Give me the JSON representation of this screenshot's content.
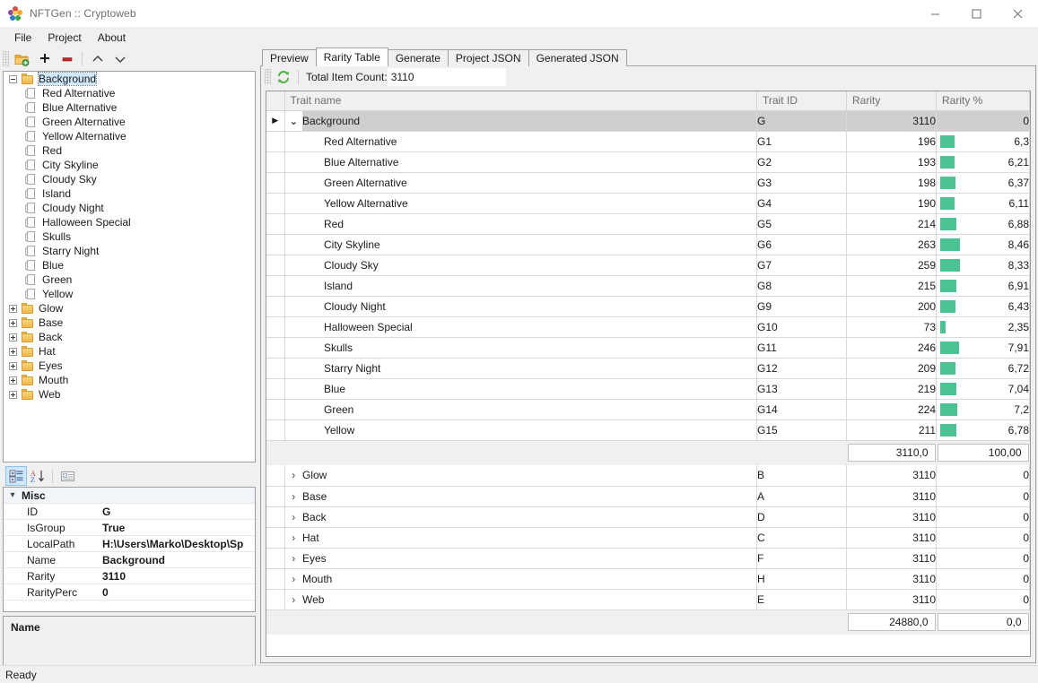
{
  "window": {
    "title": "NFTGen :: Cryptoweb",
    "icon": "app-flower-icon",
    "minimize": "minimize-icon",
    "maximize": "maximize-icon",
    "close": "close-icon"
  },
  "menu": {
    "items": [
      {
        "label": "File"
      },
      {
        "label": "Project"
      },
      {
        "label": "About"
      }
    ]
  },
  "tree_toolbar": {
    "buttons": [
      {
        "name": "add-folder-icon",
        "title": "Add group"
      },
      {
        "name": "plus-icon",
        "title": "Add item"
      },
      {
        "name": "minus-icon",
        "title": "Remove item"
      },
      {
        "name": "move-up-icon",
        "title": "Move up"
      },
      {
        "name": "move-down-icon",
        "title": "Move down"
      }
    ]
  },
  "tree": {
    "nodes": [
      {
        "label": "Background",
        "type": "folder",
        "expanded": true,
        "selected": true
      },
      {
        "label": "Red Alternative",
        "type": "file"
      },
      {
        "label": "Blue Alternative",
        "type": "file"
      },
      {
        "label": "Green Alternative",
        "type": "file"
      },
      {
        "label": "Yellow Alternative",
        "type": "file"
      },
      {
        "label": "Red",
        "type": "file"
      },
      {
        "label": "City Skyline",
        "type": "file"
      },
      {
        "label": "Cloudy Sky",
        "type": "file"
      },
      {
        "label": "Island",
        "type": "file"
      },
      {
        "label": "Cloudy Night",
        "type": "file"
      },
      {
        "label": "Halloween Special",
        "type": "file"
      },
      {
        "label": "Skulls",
        "type": "file"
      },
      {
        "label": "Starry Night",
        "type": "file"
      },
      {
        "label": "Blue",
        "type": "file"
      },
      {
        "label": "Green",
        "type": "file"
      },
      {
        "label": "Yellow",
        "type": "file"
      },
      {
        "label": "Glow",
        "type": "folder",
        "expanded": false
      },
      {
        "label": "Base",
        "type": "folder",
        "expanded": false
      },
      {
        "label": "Back",
        "type": "folder",
        "expanded": false
      },
      {
        "label": "Hat",
        "type": "folder",
        "expanded": false
      },
      {
        "label": "Eyes",
        "type": "folder",
        "expanded": false
      },
      {
        "label": "Mouth",
        "type": "folder",
        "expanded": false
      },
      {
        "label": "Web",
        "type": "folder",
        "expanded": false
      }
    ]
  },
  "propgrid_toolbar": {
    "buttons": [
      {
        "name": "categorized-view-icon",
        "active": true
      },
      {
        "name": "alphabetical-sort-icon",
        "active": false
      },
      {
        "name": "property-pages-icon",
        "active": false
      }
    ]
  },
  "propgrid": {
    "category": "Misc",
    "rows": [
      {
        "name": "ID",
        "value": "G"
      },
      {
        "name": "IsGroup",
        "value": "True"
      },
      {
        "name": "LocalPath",
        "value": "H:\\Users\\Marko\\Desktop\\Sp"
      },
      {
        "name": "Name",
        "value": "Background"
      },
      {
        "name": "Rarity",
        "value": "3110"
      },
      {
        "name": "RarityPerc",
        "value": "0"
      }
    ]
  },
  "description_box": {
    "title": "Name",
    "text": ""
  },
  "tabs": [
    {
      "label": "Preview",
      "active": false
    },
    {
      "label": "Rarity Table",
      "active": true
    },
    {
      "label": "Generate",
      "active": false
    },
    {
      "label": "Project JSON",
      "active": false
    },
    {
      "label": "Generated JSON",
      "active": false
    }
  ],
  "grid_toolbar": {
    "refresh_icon": "refresh-icon",
    "total_label": "Total Item Count:",
    "total_value": "3110"
  },
  "table": {
    "columns": [
      "Trait name",
      "Trait ID",
      "Rarity",
      "Rarity %"
    ],
    "accent_color": "#4bc291",
    "expanded_group": {
      "name": "Background",
      "id": "G",
      "rarity": "3110",
      "pct": "0",
      "children": [
        {
          "name": "Red Alternative",
          "id": "G1",
          "rarity": "196",
          "pct": "6,3",
          "pct_value": 6.3
        },
        {
          "name": "Blue Alternative",
          "id": "G2",
          "rarity": "193",
          "pct": "6,21",
          "pct_value": 6.21
        },
        {
          "name": "Green Alternative",
          "id": "G3",
          "rarity": "198",
          "pct": "6,37",
          "pct_value": 6.37
        },
        {
          "name": "Yellow Alternative",
          "id": "G4",
          "rarity": "190",
          "pct": "6,11",
          "pct_value": 6.11
        },
        {
          "name": "Red",
          "id": "G5",
          "rarity": "214",
          "pct": "6,88",
          "pct_value": 6.88
        },
        {
          "name": "City Skyline",
          "id": "G6",
          "rarity": "263",
          "pct": "8,46",
          "pct_value": 8.46
        },
        {
          "name": "Cloudy Sky",
          "id": "G7",
          "rarity": "259",
          "pct": "8,33",
          "pct_value": 8.33
        },
        {
          "name": "Island",
          "id": "G8",
          "rarity": "215",
          "pct": "6,91",
          "pct_value": 6.91
        },
        {
          "name": "Cloudy Night",
          "id": "G9",
          "rarity": "200",
          "pct": "6,43",
          "pct_value": 6.43
        },
        {
          "name": "Halloween Special",
          "id": "G10",
          "rarity": "73",
          "pct": "2,35",
          "pct_value": 2.35
        },
        {
          "name": "Skulls",
          "id": "G11",
          "rarity": "246",
          "pct": "7,91",
          "pct_value": 7.91
        },
        {
          "name": "Starry Night",
          "id": "G12",
          "rarity": "209",
          "pct": "6,72",
          "pct_value": 6.72
        },
        {
          "name": "Blue",
          "id": "G13",
          "rarity": "219",
          "pct": "7,04",
          "pct_value": 7.04
        },
        {
          "name": "Green",
          "id": "G14",
          "rarity": "224",
          "pct": "7,2",
          "pct_value": 7.2
        },
        {
          "name": "Yellow",
          "id": "G15",
          "rarity": "211",
          "pct": "6,78",
          "pct_value": 6.78
        }
      ],
      "summary": {
        "rarity": "3110,0",
        "pct": "100,00"
      }
    },
    "collapsed_groups": [
      {
        "name": "Glow",
        "id": "B",
        "rarity": "3110",
        "pct": "0"
      },
      {
        "name": "Base",
        "id": "A",
        "rarity": "3110",
        "pct": "0"
      },
      {
        "name": "Back",
        "id": "D",
        "rarity": "3110",
        "pct": "0"
      },
      {
        "name": "Hat",
        "id": "C",
        "rarity": "3110",
        "pct": "0"
      },
      {
        "name": "Eyes",
        "id": "F",
        "rarity": "3110",
        "pct": "0"
      },
      {
        "name": "Mouth",
        "id": "H",
        "rarity": "3110",
        "pct": "0"
      },
      {
        "name": "Web",
        "id": "E",
        "rarity": "3110",
        "pct": "0"
      }
    ],
    "footer_summary": {
      "rarity": "24880,0",
      "pct": "0,0"
    }
  },
  "statusbar": {
    "text": "Ready"
  }
}
